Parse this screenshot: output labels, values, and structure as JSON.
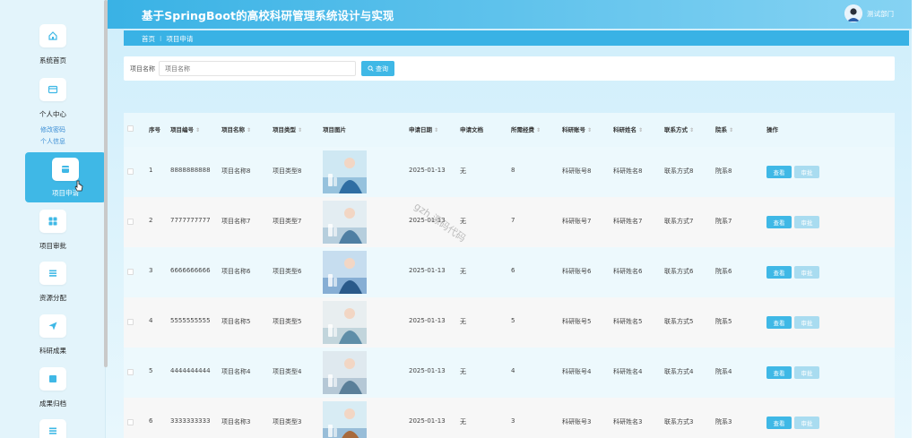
{
  "header": {
    "title": "基于SpringBoot的高校科研管理系统设计与实现",
    "user": "测试部门"
  },
  "sidebar": {
    "items": [
      {
        "label": "系统首页",
        "icon": "home-icon"
      },
      {
        "label": "个人中心",
        "icon": "wallet-icon",
        "subs": [
          "修改密码",
          "个人信息"
        ]
      },
      {
        "label": "项目申请",
        "icon": "folder-icon",
        "active": true
      },
      {
        "label": "项目审批",
        "icon": "grid-icon"
      },
      {
        "label": "资源分配",
        "icon": "list-icon"
      },
      {
        "label": "科研成果",
        "icon": "send-icon"
      },
      {
        "label": "成果归档",
        "icon": "archive-icon"
      }
    ]
  },
  "breadcrumb": {
    "home": "首页",
    "sep": "⁝",
    "current": "项目申请"
  },
  "search": {
    "label": "项目名称",
    "placeholder": "项目名称",
    "button": "查询"
  },
  "table": {
    "headers": [
      "序号",
      "项目编号",
      "项目名称",
      "项目类型",
      "项目图片",
      "申请日期",
      "申请文档",
      "所需经费",
      "科研账号",
      "科研姓名",
      "联系方式",
      "院系",
      "操作"
    ],
    "rows": [
      {
        "idx": "1",
        "code": "8888888888",
        "name": "项目名称8",
        "type": "项目类型8",
        "date": "2025-01-13",
        "doc": "无",
        "fund": "8",
        "acct": "科研账号8",
        "person": "科研姓名8",
        "contact": "联系方式8",
        "dept": "院系8"
      },
      {
        "idx": "2",
        "code": "7777777777",
        "name": "项目名称7",
        "type": "项目类型7",
        "date": "2025-01-13",
        "doc": "无",
        "fund": "7",
        "acct": "科研账号7",
        "person": "科研姓名7",
        "contact": "联系方式7",
        "dept": "院系7"
      },
      {
        "idx": "3",
        "code": "6666666666",
        "name": "项目名称6",
        "type": "项目类型6",
        "date": "2025-01-13",
        "doc": "无",
        "fund": "6",
        "acct": "科研账号6",
        "person": "科研姓名6",
        "contact": "联系方式6",
        "dept": "院系6"
      },
      {
        "idx": "4",
        "code": "5555555555",
        "name": "项目名称5",
        "type": "项目类型5",
        "date": "2025-01-13",
        "doc": "无",
        "fund": "5",
        "acct": "科研账号5",
        "person": "科研姓名5",
        "contact": "联系方式5",
        "dept": "院系5"
      },
      {
        "idx": "5",
        "code": "4444444444",
        "name": "项目名称4",
        "type": "项目类型4",
        "date": "2025-01-13",
        "doc": "无",
        "fund": "4",
        "acct": "科研账号4",
        "person": "科研姓名4",
        "contact": "联系方式4",
        "dept": "院系4"
      },
      {
        "idx": "6",
        "code": "3333333333",
        "name": "项目名称3",
        "type": "项目类型3",
        "date": "2025-01-13",
        "doc": "无",
        "fund": "3",
        "acct": "科研账号3",
        "person": "科研姓名3",
        "contact": "联系方式3",
        "dept": "院系3"
      }
    ],
    "view_label": "查看",
    "review_label": "审批"
  },
  "watermark": "gzh 源码代码",
  "colors": {
    "accent": "#3fb8e6",
    "header_start": "#39b2e5",
    "header_end": "#86d3f3"
  }
}
